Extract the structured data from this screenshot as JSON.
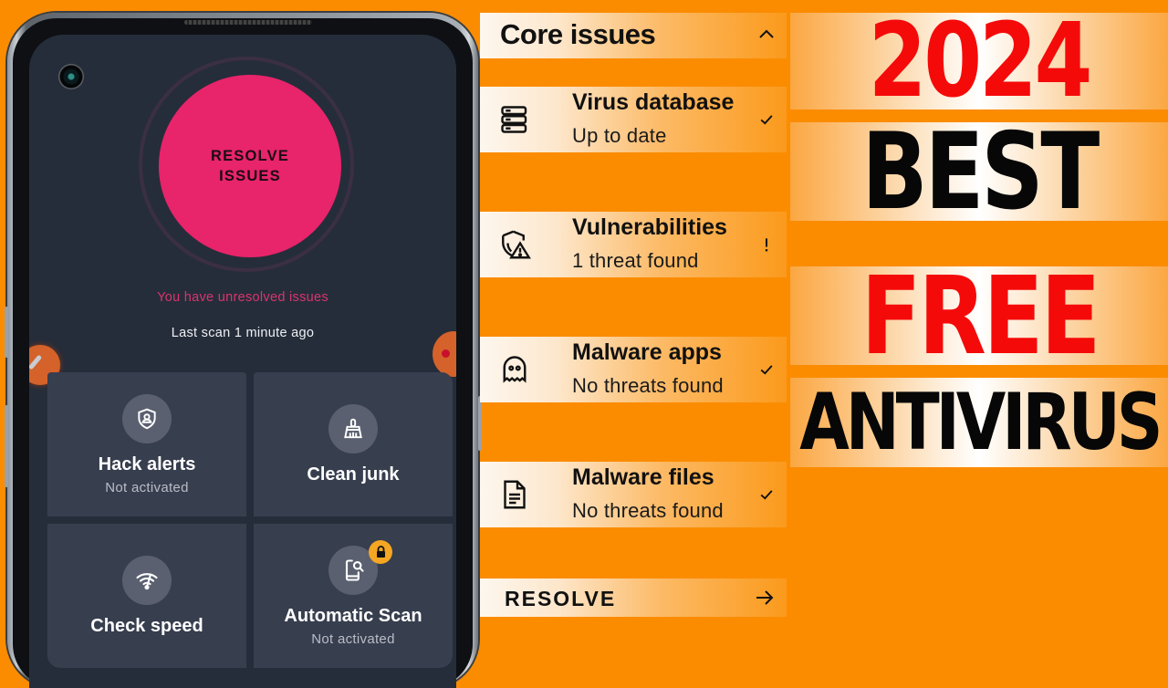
{
  "phone": {
    "resolve_button": {
      "line1": "RESOLVE",
      "line2": "ISSUES"
    },
    "status_text": "You have unresolved issues",
    "last_scan": "Last scan 1 minute ago",
    "tiles": [
      {
        "title": "Hack alerts",
        "subtitle": "Not activated",
        "icon": "shield-user-icon"
      },
      {
        "title": "Clean junk",
        "subtitle": "",
        "icon": "broom-icon"
      },
      {
        "title": "Check speed",
        "subtitle": "",
        "icon": "wifi-speed-icon"
      },
      {
        "title": "Automatic Scan",
        "subtitle": "Not activated",
        "icon": "phone-search-icon",
        "locked": true
      }
    ]
  },
  "core_issues": {
    "title": "Core issues",
    "items": [
      {
        "title": "Virus database",
        "status": "Up to date",
        "state": "ok",
        "icon": "database-icon"
      },
      {
        "title": "Vulnerabilities",
        "status": "1 threat found",
        "state": "warning",
        "icon": "shield-warning-icon"
      },
      {
        "title": "Malware apps",
        "status": "No threats found",
        "state": "ok",
        "icon": "ghost-icon"
      },
      {
        "title": "Malware files",
        "status": "No threats found",
        "state": "ok",
        "icon": "document-icon"
      }
    ],
    "resolve_label": "RESOLVE"
  },
  "headline": {
    "line1": "2024",
    "line2": "BEST",
    "line3": "FREE",
    "line4": "ANTIVIRUS"
  },
  "colors": {
    "background": "#FB8C00",
    "accent_pink": "#E8246A",
    "headline_red": "#F50A0A",
    "lock_badge": "#F5A623"
  }
}
